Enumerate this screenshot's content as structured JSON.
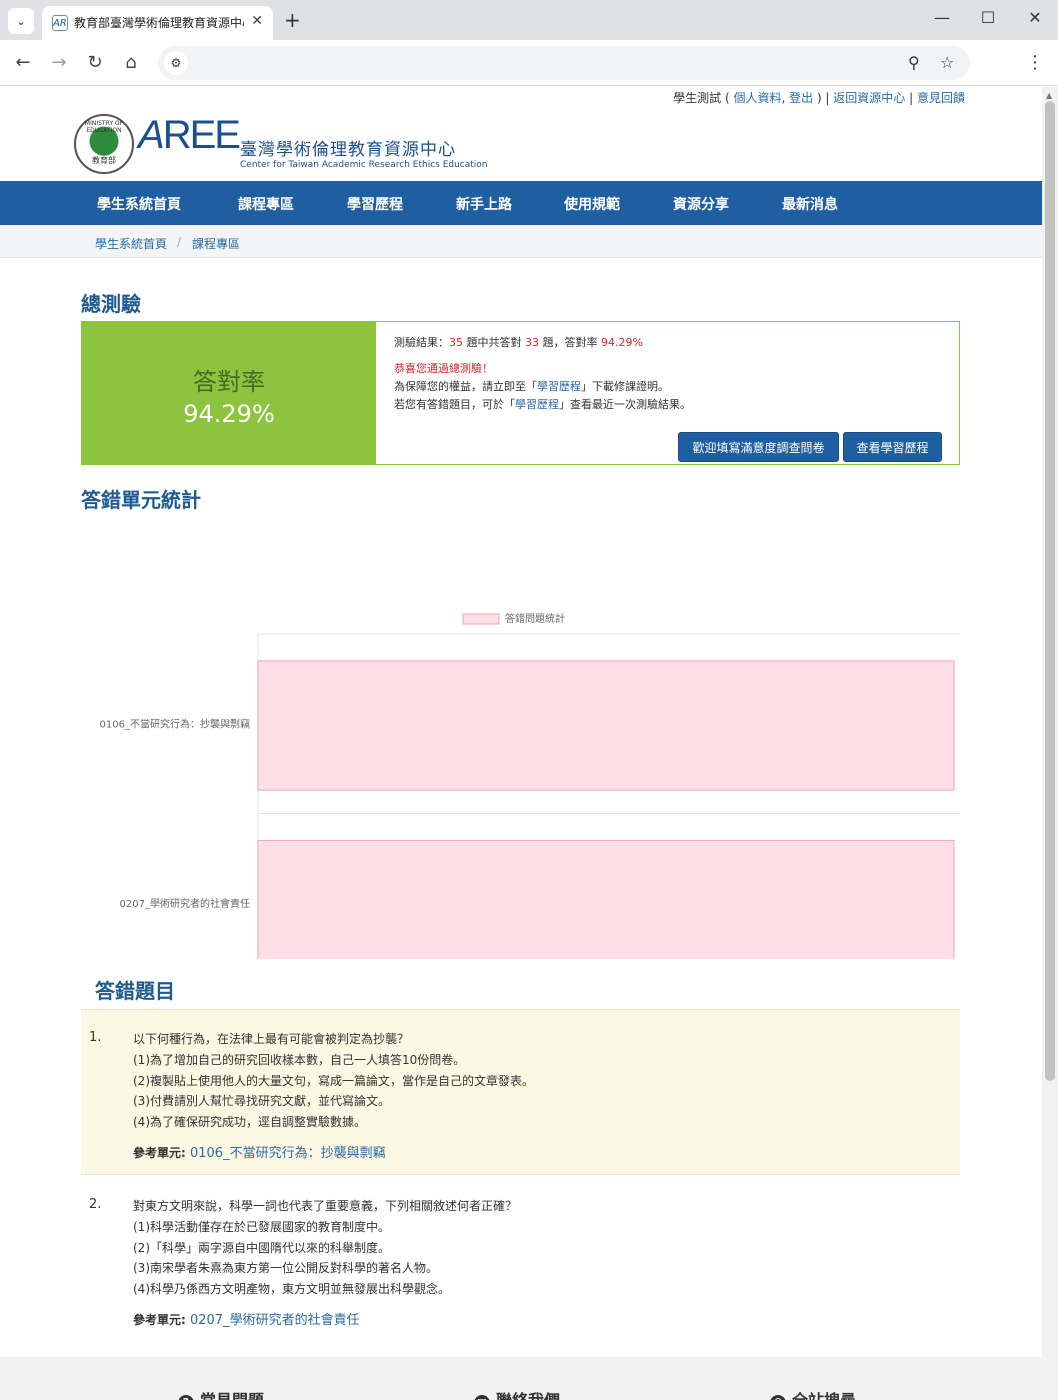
{
  "browser": {
    "tab_title": "教育部臺灣學術倫理教育資源中心",
    "favicon_text": "AR",
    "tab_close": "✕",
    "new_tab": "+",
    "win_minimize": "—",
    "win_maximize": "☐",
    "win_close": "✕",
    "back": "←",
    "forward": "→",
    "reload": "↻",
    "home": "⌂",
    "site_info": "⚙",
    "zoom": "⚲",
    "star": "☆",
    "menu": "⋮",
    "tab_search": "⌄"
  },
  "toplinks": {
    "student_test": "學生測試",
    "open_paren": " ( ",
    "profile": "個人資料",
    "comma": ", ",
    "logout": "登出",
    "close_paren": " ) | ",
    "back_to_center": "返回資源中心",
    "sep": " | ",
    "feedback": "意見回饋"
  },
  "logo": {
    "seal_text": "教育部",
    "seal_ring": "MINISTRY OF EDUCATION",
    "aree_a": "A",
    "aree_ree": "REE",
    "title_cn": "臺灣學術倫理教育資源中心",
    "title_en": "Center for Taiwan Academic Research Ethics Education"
  },
  "nav": {
    "items": [
      "學生系統首頁",
      "課程專區",
      "學習歷程",
      "新手上路",
      "使用規範",
      "資源分享",
      "最新消息"
    ]
  },
  "breadcrumb": {
    "home": "學生系統首頁",
    "sep": "/",
    "current": "課程專區"
  },
  "exam": {
    "title": "總測驗",
    "rate_label": "答對率",
    "rate_value": "94.29%",
    "rate_fraction": 0.9429,
    "result_prefix": "測驗結果：",
    "total": "35",
    "mid": " 題中共答對 ",
    "correct": "33",
    "suffix": " 題，答對率 ",
    "rate_inline": "94.29%",
    "congrats": "恭喜您通過總測驗！",
    "line2_a": "為保障您的權益，請立即至「",
    "line2_link": "學習歷程",
    "line2_b": "」下載修課證明。",
    "line3_a": "若您有答錯題目，可於「",
    "line3_link": "學習歷程",
    "line3_b": "」查看最近一次測驗結果。",
    "survey_button": "歡迎填寫滿意度調查問卷",
    "history_button": "查看學習歷程"
  },
  "stats": {
    "title": "答錯單元統計"
  },
  "chart_data": {
    "type": "bar",
    "orientation": "horizontal",
    "categories": [
      "0106_不當研究行為：抄襲與剽竊",
      "0207_學術研究者的社會責任"
    ],
    "series": [
      {
        "name": "答錯問題統計",
        "values": [
          1,
          1
        ]
      }
    ],
    "xlim": [
      0,
      1
    ],
    "x_ticks": [
      "0",
      "1"
    ],
    "legend": "top",
    "grid": true,
    "colors": {
      "fill": "#ffdfe5",
      "stroke": "#f3a3b4",
      "grid": "#e5e5e5",
      "text": "#666666"
    }
  },
  "wrong": {
    "title": "答錯題目",
    "ref_label": "參考單元: ",
    "questions": [
      {
        "num": "1.",
        "text": "以下何種行為，在法律上最有可能會被判定為抄襲？",
        "options": [
          "(1)為了增加自己的研究回收樣本數，自己一人填答10份問卷。",
          "(2)複製貼上使用他人的大量文句，寫成一篇論文，當作是自己的文章發表。",
          "(3)付費請別人幫忙尋找研究文獻，並代寫論文。",
          "(4)為了確保研究成功，逕自調整實驗數據。"
        ],
        "ref": "0106_不當研究行為：抄襲與剽竊"
      },
      {
        "num": "2.",
        "text": "對東方文明來說，科學一詞也代表了重要意義，下列相關敘述何者正確？",
        "options": [
          "(1)科學活動僅存在於已發展國家的教育制度中。",
          "(2)「科學」兩字源自中國隋代以來的科舉制度。",
          "(3)南宋學者朱熹為東方第一位公開反對科學的著名人物。",
          "(4)科學乃係西方文明產物，東方文明並無發展出科學觀念。"
        ],
        "ref": "0207_學術研究者的社會責任"
      }
    ]
  },
  "footer": {
    "faq_icon": "?",
    "faq": "常見問題",
    "contact_icon": "✉",
    "contact": "聯絡我們",
    "search_icon": "⚲",
    "search": "全站搜尋"
  }
}
